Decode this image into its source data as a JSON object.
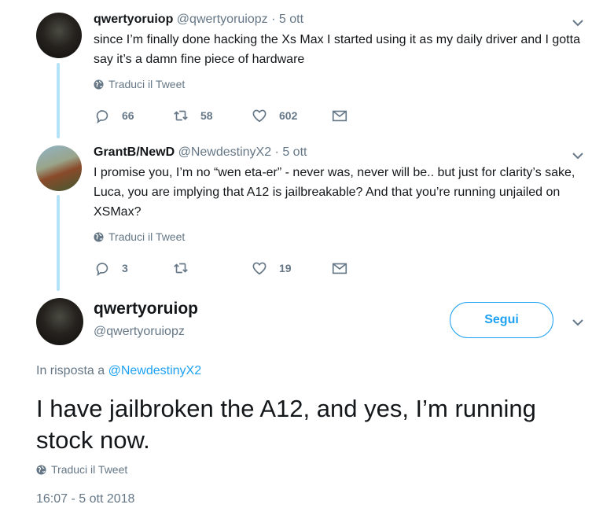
{
  "tweets": [
    {
      "name": "qwertyoruiop",
      "handle": "@qwertyoruiopz",
      "dot": "·",
      "time": "5 ott",
      "text": "since I’m finally done hacking the Xs Max I started using it as my daily driver and I gotta say it’s a damn fine piece of hardware",
      "translate_label": "Traduci il Tweet",
      "replies": "66",
      "retweets": "58",
      "likes": "602"
    },
    {
      "name": "GrantB/NewD",
      "handle": "@NewdestinyX2",
      "dot": "·",
      "time": "5 ott",
      "text": "I promise you, I’m no “wen eta-er” - never was, never will be.. but just for clarity’s sake, Luca, you are implying that A12 is jailbreakable? And that you’re running unjailed on XSMax?",
      "translate_label": "Traduci il Tweet",
      "replies": "3",
      "retweets": "",
      "likes": "19"
    }
  ],
  "main_tweet": {
    "name": "qwertyoruiop",
    "handle": "@qwertyoruiopz",
    "follow_label": "Segui",
    "reply_prefix": "In risposta a",
    "reply_to": "@NewdestinyX2",
    "text": "I have jailbroken the A12, and yes, I’m running stock now.",
    "translate_label": "Traduci il Tweet",
    "timestamp": "16:07 - 5 ott 2018"
  },
  "colors": {
    "accent": "#1da1f2",
    "muted": "#657786",
    "thread_line": "#b4e2f8"
  },
  "icons": [
    "chevron-down-icon",
    "globe-icon",
    "reply-icon",
    "retweet-icon",
    "like-icon",
    "message-icon"
  ]
}
